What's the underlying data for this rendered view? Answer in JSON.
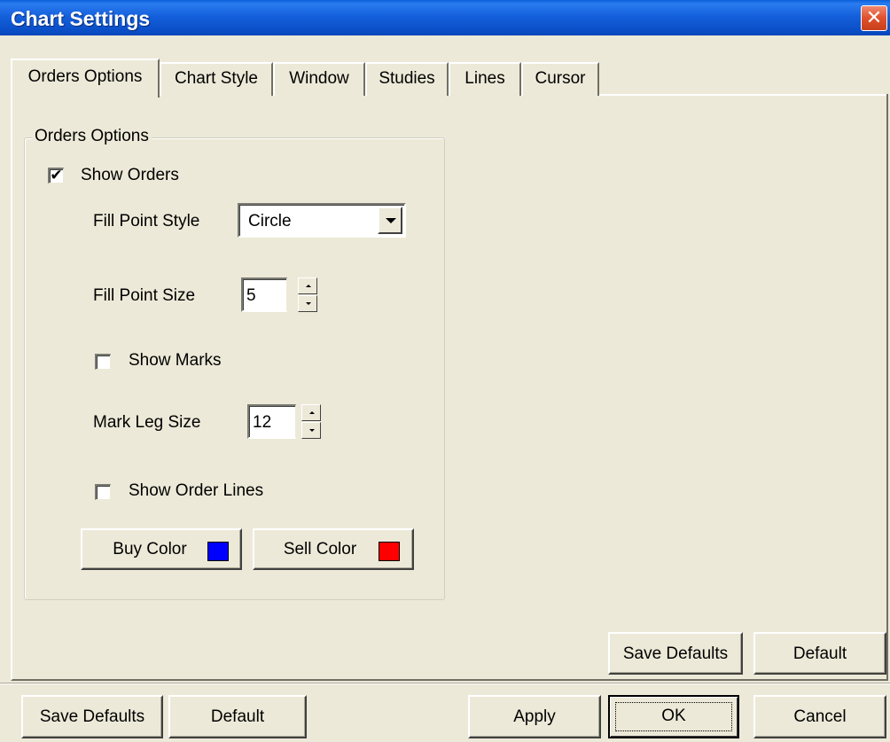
{
  "window": {
    "title": "Chart Settings",
    "close_glyph": "✕"
  },
  "tabs": [
    {
      "label": "Orders Options",
      "active": true
    },
    {
      "label": "Chart Style",
      "active": false
    },
    {
      "label": "Window",
      "active": false
    },
    {
      "label": "Studies",
      "active": false
    },
    {
      "label": "Lines",
      "active": false
    },
    {
      "label": "Cursor",
      "active": false
    }
  ],
  "orders_options": {
    "group_title": "Orders Options",
    "show_orders": {
      "label": "Show Orders",
      "checked": true,
      "check_glyph": "✔"
    },
    "fill_point_style": {
      "label": "Fill Point Style",
      "value": "Circle"
    },
    "fill_point_size": {
      "label": "Fill Point Size",
      "value": "5"
    },
    "show_marks": {
      "label": "Show Marks",
      "checked": false
    },
    "mark_leg_size": {
      "label": "Mark Leg Size",
      "value": "12"
    },
    "show_order_lines": {
      "label": "Show Order Lines",
      "checked": false
    },
    "buy_color": {
      "label": "Buy Color",
      "color": "#0000ff"
    },
    "sell_color": {
      "label": "Sell Color",
      "color": "#ff0000"
    }
  },
  "page_buttons": {
    "save_defaults": "Save Defaults",
    "default": "Default"
  },
  "dialog_buttons": {
    "save_defaults": "Save Defaults",
    "default": "Default",
    "apply": "Apply",
    "ok": "OK",
    "cancel": "Cancel"
  },
  "colors": {
    "face": "#ece9d8",
    "titlebar": "#0a5fd8",
    "close": "#e0502c"
  }
}
